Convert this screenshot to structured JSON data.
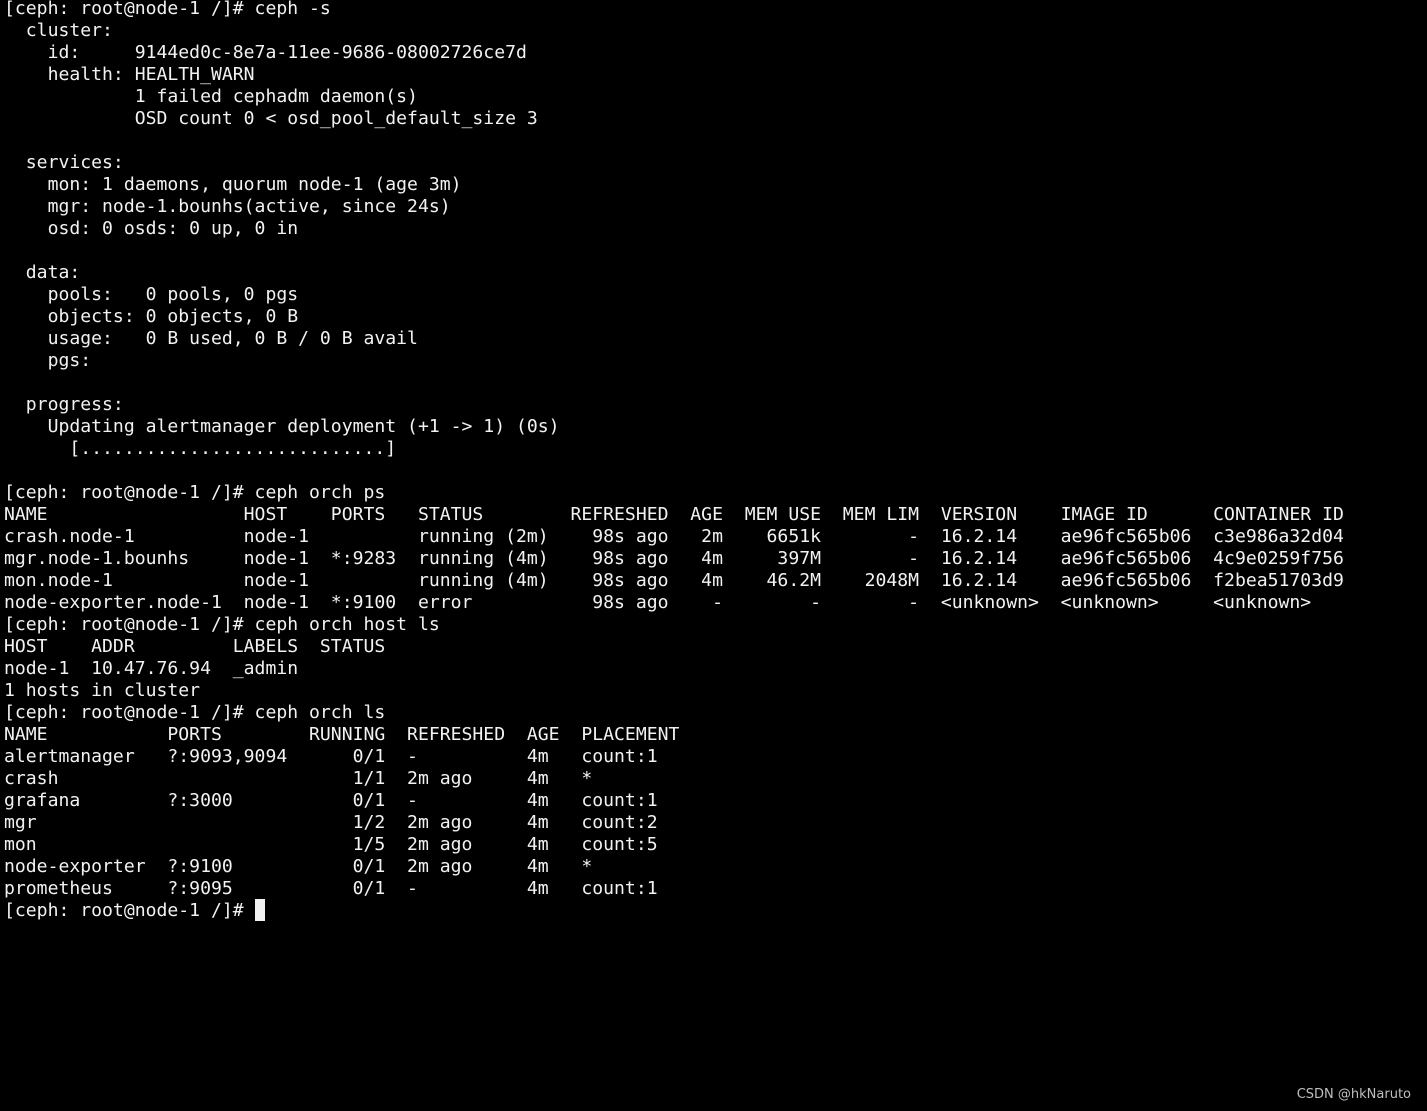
{
  "terminal": {
    "lines": [
      "[ceph: root@node-1 /]# ceph -s",
      "  cluster:",
      "    id:     9144ed0c-8e7a-11ee-9686-08002726ce7d",
      "    health: HEALTH_WARN",
      "            1 failed cephadm daemon(s)",
      "            OSD count 0 < osd_pool_default_size 3",
      "",
      "  services:",
      "    mon: 1 daemons, quorum node-1 (age 3m)",
      "    mgr: node-1.bounhs(active, since 24s)",
      "    osd: 0 osds: 0 up, 0 in",
      "",
      "  data:",
      "    pools:   0 pools, 0 pgs",
      "    objects: 0 objects, 0 B",
      "    usage:   0 B used, 0 B / 0 B avail",
      "    pgs:",
      "",
      "  progress:",
      "    Updating alertmanager deployment (+1 -> 1) (0s)",
      "      [............................]",
      "",
      "[ceph: root@node-1 /]# ceph orch ps",
      "NAME                  HOST    PORTS   STATUS        REFRESHED  AGE  MEM USE  MEM LIM  VERSION    IMAGE ID      CONTAINER ID",
      "crash.node-1          node-1          running (2m)    98s ago   2m    6651k        -  16.2.14    ae96fc565b06  c3e986a32d04",
      "mgr.node-1.bounhs     node-1  *:9283  running (4m)    98s ago   4m     397M        -  16.2.14    ae96fc565b06  4c9e0259f756",
      "mon.node-1            node-1          running (4m)    98s ago   4m    46.2M    2048M  16.2.14    ae96fc565b06  f2bea51703d9",
      "node-exporter.node-1  node-1  *:9100  error           98s ago    -        -        -  <unknown>  <unknown>     <unknown>",
      "[ceph: root@node-1 /]# ceph orch host ls",
      "HOST    ADDR         LABELS  STATUS",
      "node-1  10.47.76.94  _admin",
      "1 hosts in cluster",
      "[ceph: root@node-1 /]# ceph orch ls",
      "NAME           PORTS        RUNNING  REFRESHED  AGE  PLACEMENT",
      "alertmanager   ?:9093,9094      0/1  -          4m   count:1",
      "crash                           1/1  2m ago     4m   *",
      "grafana        ?:3000           0/1  -          4m   count:1",
      "mgr                             1/2  2m ago     4m   count:2",
      "mon                             1/5  2m ago     4m   count:5",
      "node-exporter  ?:9100           0/1  2m ago     4m   *",
      "prometheus     ?:9095           0/1  -          4m   count:1",
      "[ceph: root@node-1 /]# "
    ]
  },
  "watermark": "CSDN @hkNaruto",
  "colors": {
    "background": "#000000",
    "foreground": "#f2f2f2"
  }
}
